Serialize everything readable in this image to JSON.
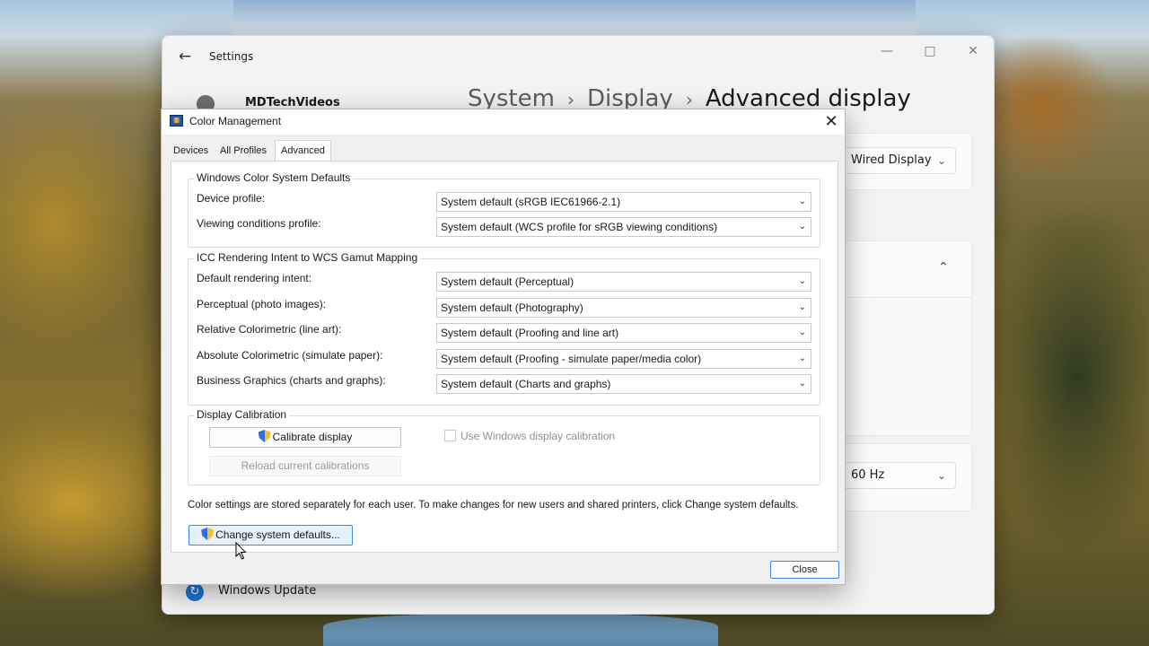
{
  "settings": {
    "app_title": "Settings",
    "back_icon": "arrow-left-icon",
    "window_controls": [
      "minimize-icon",
      "maximize-icon",
      "close-icon"
    ],
    "user_name": "MDTechVideos",
    "breadcrumb": [
      "System",
      "Display",
      "Advanced display"
    ],
    "display_select": "Wired Display",
    "refresh_rate": "60 Hz",
    "nav_windows_update": "Windows Update"
  },
  "dialog": {
    "title": "Color Management",
    "tabs": [
      {
        "label": "Devices",
        "active": false
      },
      {
        "label": "All Profiles",
        "active": false
      },
      {
        "label": "Advanced",
        "active": true
      }
    ],
    "wcs_group": {
      "title": "Windows Color System Defaults",
      "rows": [
        {
          "label": "Device profile:",
          "value": "System default (sRGB IEC61966-2.1)"
        },
        {
          "label": "Viewing conditions profile:",
          "value": "System default (WCS profile for sRGB viewing conditions)"
        }
      ]
    },
    "icc_group": {
      "title": "ICC Rendering Intent to WCS Gamut Mapping",
      "rows": [
        {
          "label": "Default rendering intent:",
          "value": "System default (Perceptual)"
        },
        {
          "label": "Perceptual (photo images):",
          "value": "System default (Photography)"
        },
        {
          "label": "Relative Colorimetric (line art):",
          "value": "System default (Proofing and line art)"
        },
        {
          "label": "Absolute Colorimetric (simulate paper):",
          "value": "System default (Proofing - simulate paper/media color)"
        },
        {
          "label": "Business Graphics (charts and graphs):",
          "value": "System default (Charts and graphs)"
        }
      ]
    },
    "calibration_group": {
      "title": "Display Calibration",
      "calibrate_button": "Calibrate display",
      "reload_button": "Reload current calibrations",
      "use_windows_calibration": "Use Windows display calibration",
      "use_windows_calibration_checked": false
    },
    "info_text": "Color settings are stored separately for each user. To make changes for new users and shared printers, click Change system defaults.",
    "change_defaults_button": "Change system defaults...",
    "close_button": "Close"
  },
  "colors": {
    "accent_blue": "#3c8be0",
    "dialog_bg": "#f0f0f0",
    "settings_bg": "#f3f3f3"
  }
}
